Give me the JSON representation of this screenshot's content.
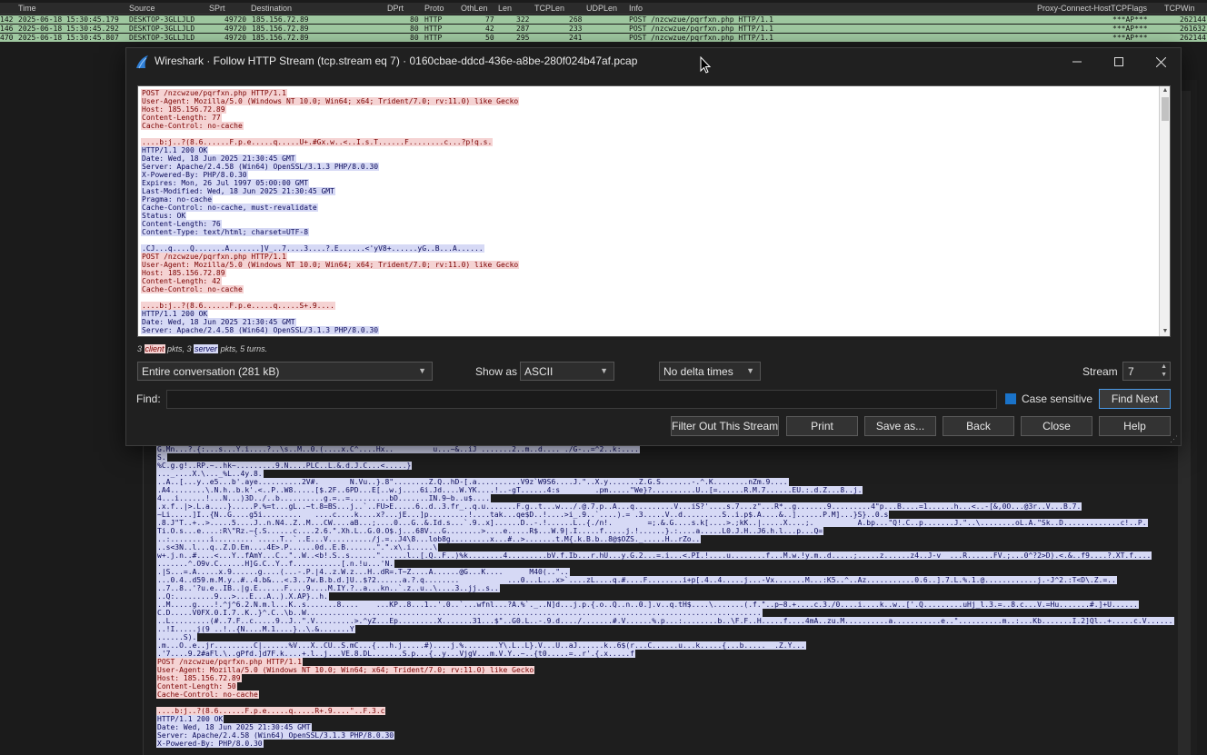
{
  "packet_list": {
    "columns": [
      "Time",
      "Source",
      "SPrt",
      "Destination",
      "DPrt",
      "Proto",
      "OthLen",
      "Len",
      "TCPLen",
      "UDPLen",
      "Info",
      "Proxy-Connect-Host",
      "TCPFlags",
      "TCPWin"
    ],
    "rows": [
      {
        "no": "142",
        "time": "2025-06-18 15:30:45.179",
        "source": "DESKTOP-3GLLJLD",
        "sprt": "49720",
        "dest": "185.156.72.89",
        "dprt": "80",
        "proto": "HTTP",
        "othlen": "77",
        "len": "322",
        "tcplen": "268",
        "info": "POST /nzcwzue/pqrfxn.php HTTP/1.1",
        "flags": "***AP***",
        "win": "262144"
      },
      {
        "no": "146",
        "time": "2025-06-18 15:30:45.292",
        "source": "DESKTOP-3GLLJLD",
        "sprt": "49720",
        "dest": "185.156.72.89",
        "dprt": "80",
        "proto": "HTTP",
        "othlen": "42",
        "len": "287",
        "tcplen": "233",
        "info": "POST /nzcwzue/pqrfxn.php HTTP/1.1",
        "flags": "***AP***",
        "win": "261632"
      },
      {
        "no": "470",
        "time": "2025-06-18 15:30:45.807",
        "source": "DESKTOP-3GLLJLD",
        "sprt": "49720",
        "dest": "185.156.72.89",
        "dprt": "80",
        "proto": "HTTP",
        "othlen": "50",
        "len": "295",
        "tcplen": "241",
        "info": "POST /nzcwzue/pqrfxn.php HTTP/1.1",
        "flags": "***AP***",
        "win": "262144"
      }
    ]
  },
  "dialog": {
    "title": "Wireshark · Follow HTTP Stream (tcp.stream eq 7) · 0160cbae-ddcd-436e-a8be-280f024b47af.pcap",
    "stream_lines": [
      {
        "t": "c",
        "text": "POST /nzcwzue/pqrfxn.php HTTP/1.1"
      },
      {
        "t": "c",
        "text": "User-Agent: Mozilla/5.0 (Windows NT 10.0; Win64; x64; Trident/7.0; rv:11.0) like Gecko"
      },
      {
        "t": "c",
        "text": "Host: 185.156.72.89"
      },
      {
        "t": "c",
        "text": "Content-Length: 77"
      },
      {
        "t": "c",
        "text": "Cache-Control: no-cache"
      },
      {
        "t": "gap",
        "text": ""
      },
      {
        "t": "c",
        "text": "....b:j..?(8.6......F.p.e.....q.....U+.#Gx.w..<..I.s.T......F........c...?p!q.s."
      },
      {
        "t": "s",
        "text": "HTTP/1.1 200 OK"
      },
      {
        "t": "s",
        "text": "Date: Wed, 18 Jun 2025 21:30:45 GMT"
      },
      {
        "t": "s",
        "text": "Server: Apache/2.4.58 (Win64) OpenSSL/3.1.3 PHP/8.0.30"
      },
      {
        "t": "s",
        "text": "X-Powered-By: PHP/8.0.30"
      },
      {
        "t": "s",
        "text": "Expires: Mon, 26 Jul 1997 05:00:00 GMT"
      },
      {
        "t": "s",
        "text": "Last-Modified: Wed, 18 Jun 2025 21:30:45 GMT"
      },
      {
        "t": "s",
        "text": "Pragma: no-cache"
      },
      {
        "t": "s",
        "text": "Cache-Control: no-cache, must-revalidate"
      },
      {
        "t": "s",
        "text": "Status: OK"
      },
      {
        "t": "s",
        "text": "Content-Length: 76"
      },
      {
        "t": "s",
        "text": "Content-Type: text/html; charset=UTF-8"
      },
      {
        "t": "gap",
        "text": ""
      },
      {
        "t": "s",
        "text": ".CJ...q....Q.......A.......]V_..7....3....?.E......<'yV8+......yG..B...A......"
      },
      {
        "t": "c",
        "text": "POST /nzcwzue/pqrfxn.php HTTP/1.1"
      },
      {
        "t": "c",
        "text": "User-Agent: Mozilla/5.0 (Windows NT 10.0; Win64; x64; Trident/7.0; rv:11.0) like Gecko"
      },
      {
        "t": "c",
        "text": "Host: 185.156.72.89"
      },
      {
        "t": "c",
        "text": "Content-Length: 42"
      },
      {
        "t": "c",
        "text": "Cache-Control: no-cache"
      },
      {
        "t": "gap",
        "text": ""
      },
      {
        "t": "c",
        "text": "....b:j..?(8.6......F.p.e.....q.....S+.9...."
      },
      {
        "t": "s",
        "text": "HTTP/1.1 200 OK"
      },
      {
        "t": "s",
        "text": "Date: Wed, 18 Jun 2025 21:30:45 GMT"
      },
      {
        "t": "s",
        "text": "Server: Apache/2.4.58 (Win64) OpenSSL/3.1.3 PHP/8.0.30"
      }
    ],
    "summary_prefix": "3 ",
    "summary_client": "client",
    "summary_mid": " pkts, 3 ",
    "summary_server": "server",
    "summary_suffix": " pkts, 5 turns.",
    "conversation_select": "Entire conversation (281 kB)",
    "show_as_label": "Show as",
    "show_as_value": "ASCII",
    "delta_select": "No delta times",
    "stream_label": "Stream",
    "stream_value": "7",
    "find_label": "Find:",
    "find_value": "",
    "case_sensitive_label": "Case sensitive",
    "case_sensitive_checked": true,
    "buttons": {
      "find_next": "Find Next",
      "filter_out": "Filter Out This Stream",
      "print": "Print",
      "save_as": "Save as...",
      "back": "Back",
      "close": "Close",
      "help": "Help"
    }
  },
  "background_stream_lines": [
    {
      "t": "s",
      "text": "G.Mn...?.{:...s...Y.i....?..\\s..M..0.(....x.C^....Hx..         u...~&..iJ .......2..m..d.... ./G-..=^2..k:...."
    },
    {
      "t": "s",
      "text": "S."
    },
    {
      "t": "s",
      "text": "%C.g.g!..RP.~..hk~.........9.N....PLC..L.&.d.J.C...<.....}"
    },
    {
      "t": "s",
      "text": "..._....X.\\..._%L..4y.8."
    },
    {
      "t": "s",
      "text": "..A..[...y..e5...b'.aye..........2V#.       N.Vu..}.8\"........Z.Q..hD-[.a..........V9z`W9S6....J.\"..X.y.......Z.G.S.......-.^.K........nZm.9...."
    },
    {
      "t": "s",
      "text": ".A4........\\.N.h..b.k'.<..P..W8.....[$.2F..6PD...E[..w.j....6i.Jd....W.YK....!..-gT......4:s        .pm.....\"We}?..........U..[=......R.M.7......EU.:.d.Z...8..j."
    },
    {
      "t": "s",
      "text": "4...i......!...N...)3D../..b..........g.=..=.........bD.......IN.9~b..u$...."
    },
    {
      "t": "s",
      "text": ".x.f..|>.L.a....}.....P.%=t...gL..~t.8=BS...j..`..FU>E.....6..d..3.fr_..q.u.......F.g..t...w.../.@.7.p..A...q.........V...iS?'....s.7...z\"...R*..g.......9.........4\"p...B....=1......h...<..-[&,0O...@3r..V...B.7."
    },
    {
      "t": "s",
      "text": "~Li.....]I..{N..G....g5i.........   ....c....k....x?...jE...]p.........!....tak...qe$D..!....>i_.9..`....).= .3.....V..d.........S..i.p$.A....&..]......P.M]...}S}..0.s"
    },
    {
      "t": "s",
      "text": ".8.J\"T..+..>.....5....J..n.N4..Z..M...CW....aB...;....0...G..&.Id.s...`.9..x]......D..-.!......L..{./n!.        =;.&.G....s.k[....>.;kK..|.....X....;.          A.bp...\"Q!.C..p.......J.\"..\\........oL.A.\"Sk..D.............c!..P."
    },
    {
      "t": "s",
      "text": "Ti.O.s...e....:R\\\"Rz.~{.S......c....2.6.\".Xh.L..G.0.O$.j...68V...G........>....e.....R$...W.9|.I.....f.....j.!......}.:....a.....L0.J.H..J6.h.l...p...Q="
    },
    {
      "t": "s",
      "text": "..:.........i.........`.....T..`..E...V........../j.=..J4\\8...lob8g.........x...#..>.......t.M{.k.B.b..8@$OZS._.....H..rZo.."
    },
    {
      "t": "s",
      "text": "..s<3N..l...q..Z.D.Em....4E>.P......0d..E.B.......\".\".x\\.i.....\\"
    },
    {
      "t": "s",
      "text": "w+.j.n..#....<...Y..fAmY...C..\"..W..<b!.S..s......\"......l..[.Q..F..)%k........4.........bV.f.Ib...r.hU...y.G.2...=.i...<.PI.!....u........f...M.w.!y.m..d.....;.....z......z4..J-v  ...R......FV.;...0^?2>D).<.&..f9....?.XT.f...."
    },
    {
      "t": "s",
      "text": ".......^.O9v.C......H]G.C..Y..f...........[.n.!u...'N."
    },
    {
      "t": "s",
      "text": ".|S...=.A.....x.9......g....(...-.P.|4..z.W.z...H..dR=.T~Z....A......@G...K....      M40(..\".."
    },
    {
      "t": "s",
      "text": "...0.4..d59.m.M.y..#..4.b&...<.3..7w.B.b.d.]U..$?2......a.?.q........           ...0...L...x>`....zL....q.#....F........i+p[.4..4.....j...-Vx.......M...:K5..^..Az...........0.6..].7.L.%.1.@............j.-J^2.:T<D\\.Z.=.."
    },
    {
      "t": "s",
      "text": "..7..8..'?u.e..IB..|g.E......F....9....M.IY.?..a...kn..`.z..u..\\....3..jj..s.."
    },
    {
      "t": "s",
      "text": "..Q:.........9...>...E...A..).X.AP}..h."
    },
    {
      "t": "s",
      "text": "..M.....g....!.^j^6.2.N.m.l...K..s.......8....    ...KP..8...1..'.0..`...wfnl...?A.%`._..N]d...j.p.{.o..Q..n..0.].v..q.tH$....\\.......(.f.\"..p~8.+....c.3./0....i....k..w..['.Q.........uHj_l.3.=..8.c...V.=Hu.......#.]+U......"
    },
    {
      "t": "s",
      "text": "C.D.....V0FX.0.I.7..K..}^.C..\\b..W........................................................................................................"
    },
    {
      "t": "s",
      "text": "..L.........(#..7.F..c.....9..J..\".V.........>.^yZ...Ep.........X.......31...$\"..G0.L..-.9.d..../.......#.V......%.p...:........b..\\F.F..H.....f....4mA..zu.M..........a...........e..\"..........m..:...Kb.......I.2]Ql..+.....c.V.........~..."
    },
    {
      "t": "s",
      "text": "..!I.....j(9 ..!..{N....M.1....}..\\.&.......Y"
    },
    {
      "t": "s",
      "text": "......S)."
    },
    {
      "t": "s",
      "text": ".m...O..e..jr.........C|......%V...X..CU..S.mC...{...h.j.....#)....j.%........Y\\.L..L}.V...U..aJ......k..6$(r...C......u...k.....{...b.....  .Z.Y..."
    },
    {
      "t": "s",
      "text": ".'7....9.2#aFl.\\..gPfd.]d7F.k....+.l..j...VE.8.DL.......S.p...{..y...VjgV...m.V.Y..~..{t0.....=..r'.{.x.....f"
    },
    {
      "t": "c",
      "text": "POST /nzcwzue/pqrfxn.php HTTP/1.1"
    },
    {
      "t": "c",
      "text": "User-Agent: Mozilla/5.0 (Windows NT 10.0; Win64; x64; Trident/7.0; rv:11.0) like Gecko"
    },
    {
      "t": "c",
      "text": "Host: 185.156.72.89"
    },
    {
      "t": "c",
      "text": "Content-Length: 50"
    },
    {
      "t": "c",
      "text": "Cache-Control: no-cache"
    },
    {
      "t": "gap",
      "text": ""
    },
    {
      "t": "c",
      "text": "....b:j..?(8.6......F.p.e.....q.....R+.9....\"..F.3.c"
    },
    {
      "t": "s",
      "text": "HTTP/1.1 200 OK"
    },
    {
      "t": "s",
      "text": "Date: Wed, 18 Jun 2025 21:30:45 GMT"
    },
    {
      "t": "s",
      "text": "Server: Apache/2.4.58 (Win64) OpenSSL/3.1.3 PHP/8.0.30"
    },
    {
      "t": "s",
      "text": "X-Powered-By: PHP/8.0.30"
    }
  ]
}
